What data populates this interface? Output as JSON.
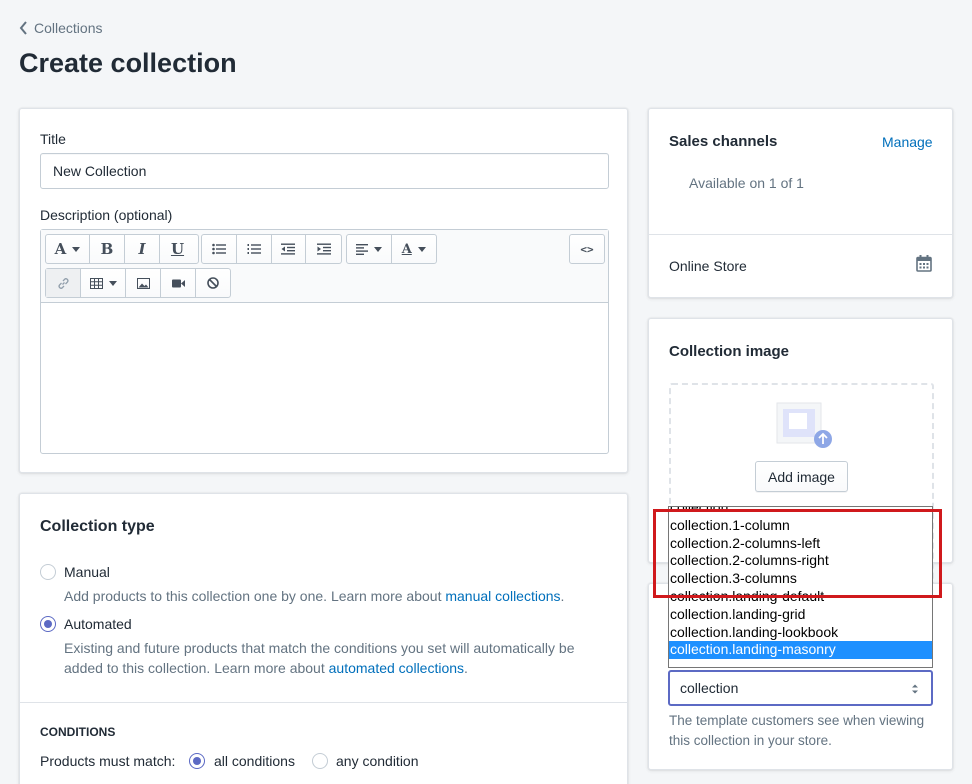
{
  "breadcrumb": {
    "label": "Collections"
  },
  "page_title": "Create collection",
  "title_field": {
    "label": "Title",
    "value": "New Collection"
  },
  "description": {
    "label": "Description (optional)",
    "html_button": "<>"
  },
  "toolbar": {
    "row1": [
      {
        "name": "font-style-button",
        "glyph": "A",
        "caret": true
      },
      {
        "name": "bold-button",
        "glyph": "B"
      },
      {
        "name": "italic-button",
        "glyph": "I"
      },
      {
        "name": "underline-button",
        "glyph": "U"
      },
      {
        "name": "bullet-list-button",
        "icon": "bullet-list-icon"
      },
      {
        "name": "numbered-list-button",
        "icon": "numbered-list-icon"
      },
      {
        "name": "outdent-button",
        "icon": "outdent-icon"
      },
      {
        "name": "indent-button",
        "icon": "indent-icon"
      },
      {
        "name": "align-button",
        "icon": "align-left-icon",
        "caret": true
      },
      {
        "name": "text-color-button",
        "glyph": "A",
        "caret": true
      }
    ],
    "row2": [
      {
        "name": "link-button",
        "icon": "link-icon"
      },
      {
        "name": "table-button",
        "icon": "table-icon",
        "caret": true
      },
      {
        "name": "insert-image-button",
        "icon": "image-icon"
      },
      {
        "name": "insert-video-button",
        "icon": "video-icon"
      },
      {
        "name": "clear-format-button",
        "icon": "clear-format-icon"
      }
    ]
  },
  "collection_type": {
    "heading": "Collection type",
    "manual": {
      "label": "Manual",
      "help_prefix": "Add products to this collection one by one. Learn more about ",
      "help_link": "manual collections",
      "help_suffix": "."
    },
    "automated": {
      "label": "Automated",
      "help_line1": "Existing and future products that match the conditions you set will automatically be",
      "help_line2_prefix": "added to this collection. Learn more about ",
      "help_link": "automated collections",
      "help_suffix": "."
    },
    "selected": "automated"
  },
  "conditions": {
    "heading": "CONDITIONS",
    "match_label": "Products must match:",
    "all_label": "all conditions",
    "any_label": "any condition",
    "selected": "all"
  },
  "sales_channels": {
    "heading": "Sales channels",
    "manage": "Manage",
    "available": "Available on 1 of 1",
    "channel": "Online Store"
  },
  "collection_image": {
    "heading": "Collection image",
    "button": "Add image"
  },
  "template": {
    "options": [
      "collection",
      "collection.1-column",
      "collection.2-columns-left",
      "collection.2-columns-right",
      "collection.3-columns",
      "collection.landing-default",
      "collection.landing-grid",
      "collection.landing-lookbook",
      "collection.landing-masonry"
    ],
    "highlighted_option": "collection.landing-masonry",
    "selected_value": "collection",
    "help_line1": "The template customers see when viewing",
    "help_line2": "this collection in your store."
  },
  "colors": {
    "accent": "#5c6ac4",
    "link": "#006fbb",
    "annotation": "#d0191c",
    "option_highlight": "#1e90ff"
  }
}
